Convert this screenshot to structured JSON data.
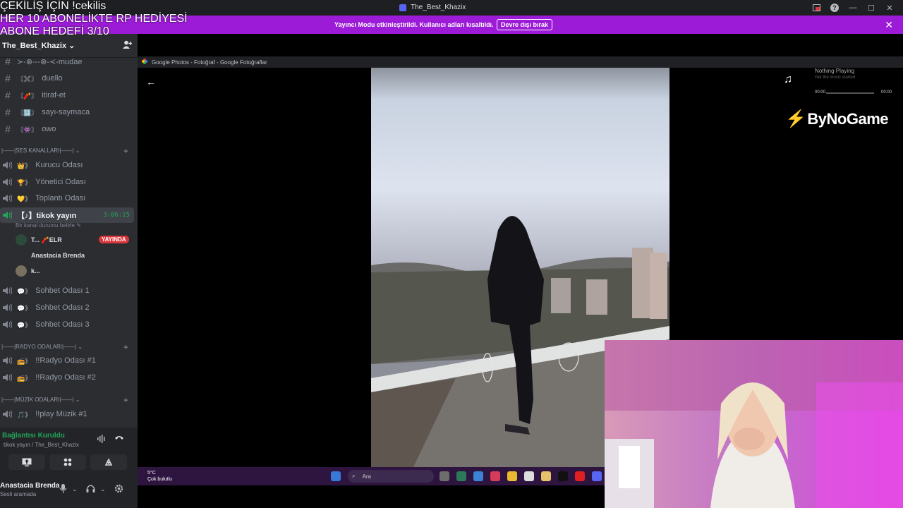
{
  "overlay": {
    "line1": "ÇEKİLİŞ İÇİN !cekilis",
    "line2": "HER 10 ABONELİKTE RP HEDİYESİ",
    "line3": "ABONE HEDEFİ 3/10"
  },
  "titlebar": {
    "title": "The_Best_Khazix"
  },
  "banner": {
    "message": "Yayıncı Modu etkinleştirildi. Kullanıcı adları kısaltıldı.",
    "button": "Devre dışı bırak",
    "close": "✕"
  },
  "sidebar": {
    "server_name": "The_Best_Khazix",
    "text_channels": [
      {
        "emoji": "",
        "name": "≻-⊗---⊗-≺-mudae"
      },
      {
        "emoji": "〘✖️〙",
        "name": "duello"
      },
      {
        "emoji": "〘🧨〙",
        "name": "itiraf-et"
      },
      {
        "emoji": "〘🔢〙",
        "name": "sayı-saymaca"
      },
      {
        "emoji": "〘👾〙",
        "name": "owo"
      }
    ],
    "category_voice": "|——|SES KANALLARI|——|",
    "voice_channels": [
      {
        "emoji": "👑》",
        "name": "Kurucu Odası"
      },
      {
        "emoji": "🏆》",
        "name": "Yönetici Odası"
      },
      {
        "emoji": "💛》",
        "name": "Toplantı Odası"
      }
    ],
    "active_channel": {
      "name": "【♪】tikok yayın",
      "timer": "3:06:15",
      "status": "Bir kanal durumu belirle ✎"
    },
    "members": [
      {
        "name": "T... 🧨ELR",
        "badge": "YAYINDA"
      },
      {
        "name": "Anastacia Brenda",
        "badge": ""
      },
      {
        "name": "k...",
        "badge": ""
      }
    ],
    "chat_channels": [
      {
        "emoji": "💬》",
        "name": "Sohbet Odası 1"
      },
      {
        "emoji": "💬》",
        "name": "Sohbet Odası 2"
      },
      {
        "emoji": "💬》",
        "name": "Sohbet Odası 3"
      }
    ],
    "category_radio": "|——|RADYO ODALARI|——|",
    "radio_channels": [
      {
        "emoji": "📻》",
        "name": "!!Radyo Odası #1"
      },
      {
        "emoji": "📻》",
        "name": "!!Radyo Odası #2"
      }
    ],
    "category_music": "|——|MÜZİK ODALARI|——|",
    "music_channels": [
      {
        "emoji": "🎵》",
        "name": "!!play Müzik #1"
      }
    ]
  },
  "voice_panel": {
    "status": "Bağlantısı Kuruldu",
    "sub": "tikok yayın / The_Best_Khazix"
  },
  "user_panel": {
    "name": "Anastacia Brenda",
    "status": "Sesli aramada"
  },
  "browser": {
    "tab_title": "Google Photos - Fotoğraf - Google Fotoğraflar"
  },
  "taskbar": {
    "temp": "5°C",
    "weather": "Çok bulutlu",
    "search": "Ara"
  },
  "music": {
    "title": "Nothing Playing",
    "subtitle": "Get the music started",
    "time_start": "00:00",
    "time_end": "00:00"
  },
  "logo": {
    "text": "ByNoGame"
  },
  "colors": {
    "banner": "#9b1bd6",
    "sidebar": "#2b2d31",
    "live": "#da373c",
    "connected": "#23a55a"
  }
}
